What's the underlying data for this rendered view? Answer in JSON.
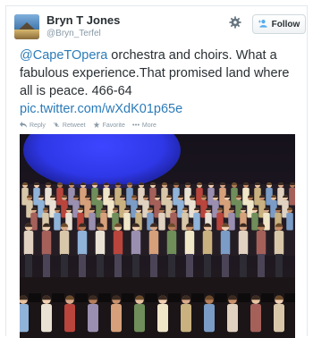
{
  "author": {
    "display_name": "Bryn T Jones",
    "screen_name": "@Bryn_Terfel"
  },
  "header": {
    "follow_label": "Follow"
  },
  "tweet": {
    "mention": "@CapeTOpera",
    "text_part1": " orchestra and choirs. What a fabulous experience.That promised land where all is peace. 466-64",
    "link": "pic.twitter.com/wXdK01p65e"
  },
  "actions": {
    "reply": "Reply",
    "retweet": "Retweet",
    "favorite": "Favorite",
    "more": "More"
  },
  "colors": {
    "link": "#2b7bb9",
    "muted": "#8899a6",
    "text": "#292f33"
  },
  "icons": [
    "gear-icon",
    "follow-person-icon",
    "reply-icon",
    "retweet-icon",
    "favorite-icon",
    "more-icon"
  ]
}
